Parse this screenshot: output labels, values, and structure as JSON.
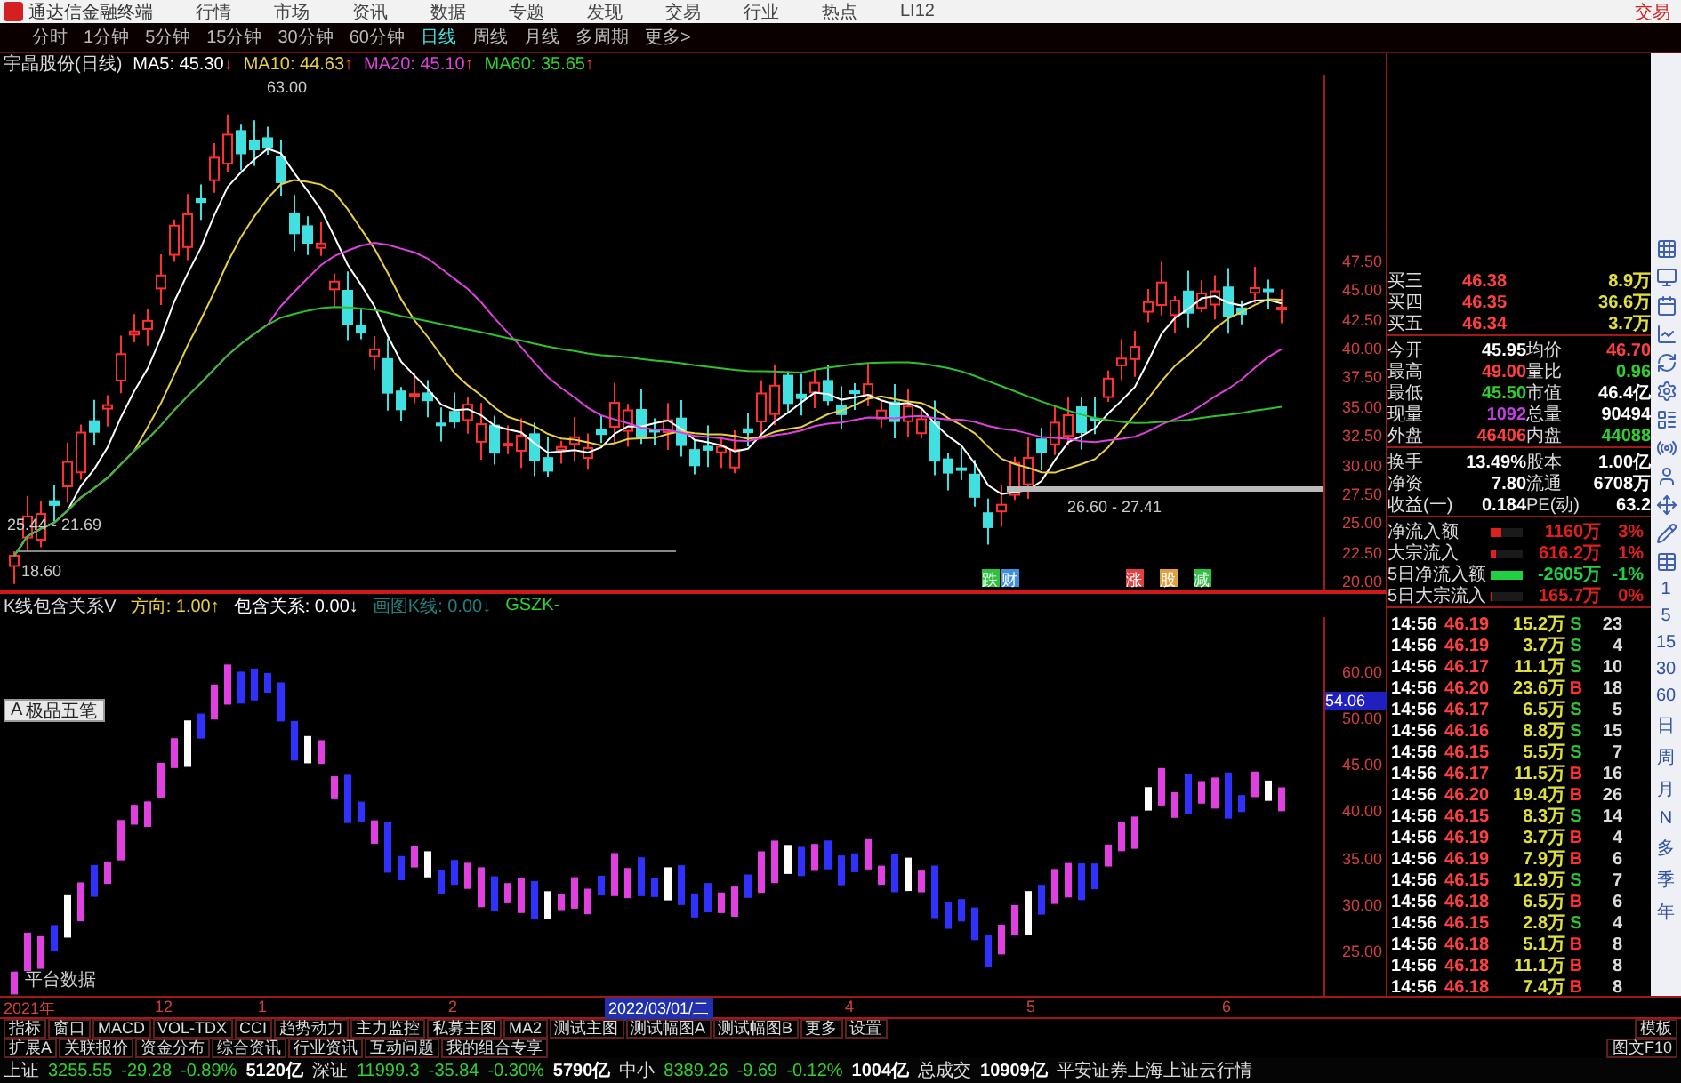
{
  "window": {
    "app_title": "通达信金融终端",
    "menus": [
      "行情",
      "市场",
      "资讯",
      "数据",
      "专题",
      "发现",
      "交易",
      "行业",
      "热点",
      "LI12"
    ],
    "trade_button": "交易"
  },
  "period_tabs": [
    {
      "label": "分时",
      "selected": false
    },
    {
      "label": "1分钟",
      "selected": false
    },
    {
      "label": "5分钟",
      "selected": false
    },
    {
      "label": "15分钟",
      "selected": false
    },
    {
      "label": "30分钟",
      "selected": false
    },
    {
      "label": "60分钟",
      "selected": false
    },
    {
      "label": "日线",
      "selected": true
    },
    {
      "label": "周线",
      "selected": false
    },
    {
      "label": "月线",
      "selected": false
    },
    {
      "label": "多周期",
      "selected": false
    },
    {
      "label": "更多>",
      "selected": false
    }
  ],
  "info_line": {
    "stock": "宇晶股份(日线)",
    "averages": [
      {
        "name": "MA5:",
        "value": "45.30",
        "arrow": "↓",
        "color": "#ffffff"
      },
      {
        "name": "MA10:",
        "value": "44.63",
        "arrow": "↑",
        "color": "#e8d040"
      },
      {
        "name": "MA20:",
        "value": "45.10",
        "arrow": "↑",
        "color": "#e040e0"
      },
      {
        "name": "MA60:",
        "value": "35.65",
        "arrow": "↑",
        "color": "#30d030"
      }
    ]
  },
  "main_chart": {
    "annotations": [
      "63.00",
      "25.44 - 21.69",
      "18.60",
      "26.60 - 27.41"
    ],
    "markers": [
      {
        "label": "跌",
        "color": "#30c040"
      },
      {
        "label": "财",
        "color": "#4090e0"
      },
      {
        "label": "涨",
        "color": "#e04040"
      },
      {
        "label": "股",
        "color": "#e0a040"
      },
      {
        "label": "减",
        "color": "#30c040"
      }
    ],
    "price_axis": [
      "47.50",
      "45.00",
      "42.50",
      "40.00",
      "37.50",
      "35.00",
      "32.50",
      "30.00",
      "27.50",
      "25.00",
      "22.50",
      "20.00"
    ]
  },
  "indicator": {
    "title": "K线包含关系V",
    "values": [
      {
        "text": "方向: 1.00↑",
        "color": "#e8d040"
      },
      {
        "text": "包含关系: 0.00↓",
        "color": "#ffffff"
      },
      {
        "text": "画图K线: 0.00↓",
        "color": "#208080"
      },
      {
        "text": "GSZK-",
        "color": "#30d030"
      }
    ],
    "axis": [
      "60.00",
      "50.00",
      "45.00",
      "40.00",
      "35.00",
      "30.00",
      "25.00"
    ],
    "cursor_value": "54.06",
    "ime_bar": {
      "mode": "A",
      "name": "极品五笔"
    },
    "footer_text": "平台数据"
  },
  "quote_panel": {
    "book": [
      {
        "label": "买三",
        "price": "46.38",
        "volume": "8.9万"
      },
      {
        "label": "买四",
        "price": "46.35",
        "volume": "36.6万"
      },
      {
        "label": "买五",
        "price": "46.34",
        "volume": "3.7万"
      }
    ],
    "stats": [
      {
        "l1": "今开",
        "v1": {
          "text": "45.95",
          "kind": "plain"
        },
        "l2": "均价",
        "v2": {
          "text": "46.70",
          "kind": "up"
        }
      },
      {
        "l1": "最高",
        "v1": {
          "text": "49.00",
          "kind": "up"
        },
        "l2": "量比",
        "v2": {
          "text": "0.96",
          "kind": "down"
        }
      },
      {
        "l1": "最低",
        "v1": {
          "text": "45.50",
          "kind": "down"
        },
        "l2": "市值",
        "v2": {
          "text": "46.4亿",
          "kind": "plain"
        }
      },
      {
        "l1": "现量",
        "v1": {
          "text": "1092",
          "kind": "vol"
        },
        "l2": "总量",
        "v2": {
          "text": "90494",
          "kind": "plain"
        }
      },
      {
        "l1": "外盘",
        "v1": {
          "text": "46406",
          "kind": "up"
        },
        "l2": "内盘",
        "v2": {
          "text": "44088",
          "kind": "down"
        }
      }
    ],
    "fundamentals": [
      {
        "l1": "换手",
        "v1": {
          "text": "13.49%",
          "kind": "plain"
        },
        "l2": "股本",
        "v2": {
          "text": "1.00亿",
          "kind": "plain"
        }
      },
      {
        "l1": "净资",
        "v1": {
          "text": "7.80",
          "kind": "plain"
        },
        "l2": "流通",
        "v2": {
          "text": "6708万",
          "kind": "plain"
        }
      },
      {
        "l1": "收益(一)",
        "v1": {
          "text": "0.184",
          "kind": "plain"
        },
        "l2": "PE(动)",
        "v2": {
          "text": "63.2",
          "kind": "plain"
        }
      }
    ],
    "flows": [
      {
        "label": "净流入额",
        "kind": "up",
        "level": 0.35,
        "value": "1160万",
        "pct": "3%"
      },
      {
        "label": "大宗流入",
        "kind": "up",
        "level": 0.15,
        "value": "616.2万",
        "pct": "1%"
      },
      {
        "label": "5日净流入额",
        "kind": "down",
        "level": 1.0,
        "value": "-2605万",
        "pct": "-1%"
      },
      {
        "label": "5日大宗流入",
        "kind": "up",
        "level": 0.05,
        "value": "165.7万",
        "pct": "0%"
      }
    ],
    "ticks": [
      {
        "time": "14:56",
        "price": "46.19",
        "volume": "15.2万",
        "side": "S",
        "kind": "sell",
        "count": "23"
      },
      {
        "time": "14:56",
        "price": "46.19",
        "volume": "3.7万",
        "side": "S",
        "kind": "sell",
        "count": "4"
      },
      {
        "time": "14:56",
        "price": "46.17",
        "volume": "11.1万",
        "side": "S",
        "kind": "sell",
        "count": "10"
      },
      {
        "time": "14:56",
        "price": "46.20",
        "volume": "23.6万",
        "side": "B",
        "kind": "buy",
        "count": "18"
      },
      {
        "time": "14:56",
        "price": "46.17",
        "volume": "6.5万",
        "side": "S",
        "kind": "sell",
        "count": "5"
      },
      {
        "time": "14:56",
        "price": "46.16",
        "volume": "8.8万",
        "side": "S",
        "kind": "sell",
        "count": "15"
      },
      {
        "time": "14:56",
        "price": "46.15",
        "volume": "5.5万",
        "side": "S",
        "kind": "sell",
        "count": "7"
      },
      {
        "time": "14:56",
        "price": "46.17",
        "volume": "11.5万",
        "side": "B",
        "kind": "buy",
        "count": "16"
      },
      {
        "time": "14:56",
        "price": "46.20",
        "volume": "19.4万",
        "side": "B",
        "kind": "buy",
        "count": "26"
      },
      {
        "time": "14:56",
        "price": "46.15",
        "volume": "8.3万",
        "side": "S",
        "kind": "sell",
        "count": "14"
      },
      {
        "time": "14:56",
        "price": "46.19",
        "volume": "3.7万",
        "side": "B",
        "kind": "buy",
        "count": "4"
      },
      {
        "time": "14:56",
        "price": "46.19",
        "volume": "7.9万",
        "side": "B",
        "kind": "buy",
        "count": "6"
      },
      {
        "time": "14:56",
        "price": "46.15",
        "volume": "12.9万",
        "side": "S",
        "kind": "sell",
        "count": "7"
      },
      {
        "time": "14:56",
        "price": "46.18",
        "volume": "6.5万",
        "side": "B",
        "kind": "buy",
        "count": "6"
      },
      {
        "time": "14:56",
        "price": "46.15",
        "volume": "2.8万",
        "side": "S",
        "kind": "sell",
        "count": "4"
      },
      {
        "time": "14:56",
        "price": "46.18",
        "volume": "5.1万",
        "side": "B",
        "kind": "buy",
        "count": "8"
      },
      {
        "time": "14:56",
        "price": "46.18",
        "volume": "11.1万",
        "side": "B",
        "kind": "buy",
        "count": "8"
      },
      {
        "time": "14:56",
        "price": "46.18",
        "volume": "7.4万",
        "side": "B",
        "kind": "buy",
        "count": "8"
      }
    ]
  },
  "side_toolbar": {
    "periods": [
      "1",
      "5",
      "15",
      "30",
      "60",
      "日",
      "周",
      "月",
      "N",
      "多",
      "季",
      "年"
    ]
  },
  "date_axis": [
    {
      "label": "2021年",
      "selected": false
    },
    {
      "label": "12",
      "selected": false
    },
    {
      "label": "1",
      "selected": false
    },
    {
      "label": "2",
      "selected": false
    },
    {
      "label": "2022/03/01/二",
      "selected": true
    },
    {
      "label": "4",
      "selected": false
    },
    {
      "label": "5",
      "selected": false
    },
    {
      "label": "6",
      "selected": false
    }
  ],
  "indicator_tabs": [
    "指标",
    "窗口",
    "MACD",
    "VOL-TDX",
    "CCI",
    "趋势动力",
    "主力监控",
    "私募主图",
    "MA2",
    "测试主图",
    "测试幅图A",
    "测试幅图B",
    "更多",
    "设置"
  ],
  "template_button": "模板",
  "extension_tabs": [
    "扩展A",
    "关联报价",
    "资金分布",
    "综合资讯",
    "行业资讯",
    "互动问题",
    "我的组合专享"
  ],
  "f10_button": "图文F10",
  "status_bar": {
    "indices": [
      {
        "name": "上证",
        "value": "3255.55",
        "change": "-29.28",
        "pct": "-0.89%",
        "amount": "5120亿"
      },
      {
        "name": "深证",
        "value": "11999.3",
        "change": "-35.84",
        "pct": "-0.30%",
        "amount": "5790亿"
      },
      {
        "name": "中小",
        "value": "8389.26",
        "change": "-9.69",
        "pct": "-0.12%",
        "amount": "1004亿"
      }
    ],
    "total_label": "总成交",
    "total_value": "10909亿",
    "broker": "平安证券上海上证云行情"
  }
}
